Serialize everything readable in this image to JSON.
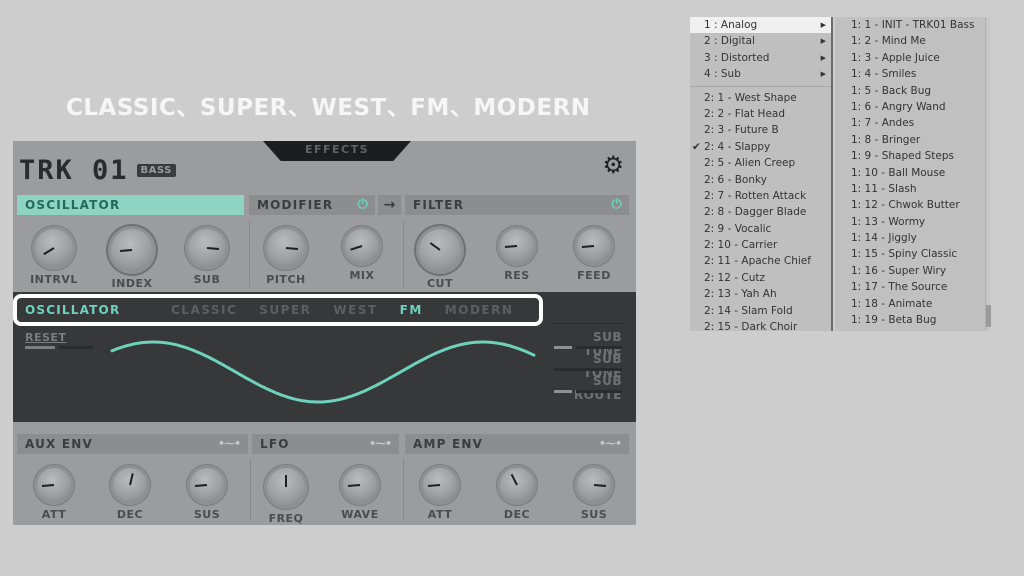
{
  "caption": "CLASSIC、SUPER、WEST、FM、MODERN",
  "synth": {
    "effects_tab": "EFFECTS",
    "logo": "TRK 01",
    "logo_badge": "BASS",
    "gear_icon": "gear-icon",
    "sections": {
      "oscillator": "OSCILLATOR",
      "modifier": "MODIFIER",
      "filter": "FILTER",
      "aux_env": "AUX ENV",
      "lfo": "LFO",
      "amp_env": "AMP ENV"
    },
    "arrow": "→",
    "power_icon": "⏻",
    "env_icon": "•⁓•",
    "knobs_top": [
      {
        "label": "INTRVL",
        "value": 0.05
      },
      {
        "label": "INDEX",
        "value": 0.15
      },
      {
        "label": "SUB",
        "value": 0.85
      },
      {
        "label": "PITCH",
        "value": 0.85
      },
      {
        "label": "MIX",
        "value": 0.1
      },
      {
        "label": "CUT",
        "value": 0.3
      },
      {
        "label": "RES",
        "value": 0.15
      },
      {
        "label": "FEED",
        "value": 0.15
      }
    ],
    "knobs_bottom": [
      {
        "label": "ATT",
        "value": 0.15
      },
      {
        "label": "DEC",
        "value": 0.55
      },
      {
        "label": "SUS",
        "value": 0.15
      },
      {
        "label": "FREQ",
        "value": 0.5
      },
      {
        "label": "WAVE",
        "value": 0.15
      },
      {
        "label": "ATT",
        "value": 0.15
      },
      {
        "label": "DEC",
        "value": 0.4
      },
      {
        "label": "SUS",
        "value": 0.85
      }
    ],
    "osc_panel": {
      "title": "OSCILLATOR",
      "tabs": [
        "CLASSIC",
        "SUPER",
        "WEST",
        "FM",
        "MODERN"
      ],
      "selected_tab": "FM",
      "reset": "RESET",
      "side_params": [
        "SUB TUNE",
        "SUB TONE",
        "SUB ROUTE"
      ]
    },
    "accent": "#6fd2bd"
  },
  "menu": {
    "categories": [
      {
        "label": "1 : Analog",
        "highlighted": true
      },
      {
        "label": "2 : Digital"
      },
      {
        "label": "3 : Distorted"
      },
      {
        "label": "4 : Sub"
      }
    ],
    "presets_left": [
      "2: 1 - West Shape",
      "2: 2 - Flat Head",
      "2: 3 - Future B",
      "2: 4 - Slappy",
      "2: 5 - Alien Creep",
      "2: 6 - Bonky",
      "2: 7 - Rotten Attack",
      "2: 8 - Dagger Blade",
      "2: 9 - Vocalic",
      "2: 10 - Carrier",
      "2: 11 - Apache Chief",
      "2: 12 - Cutz",
      "2: 13 - Yah Ah",
      "2: 14 - Slam Fold",
      "2: 15 - Dark Choir"
    ],
    "checked_left": "2: 4 - Slappy",
    "presets_right": [
      "1: 1 - INIT - TRK01 Bass",
      "1: 2 - Mind Me",
      "1: 3 - Apple Juice",
      "1: 4 - Smiles",
      "1: 5 - Back Bug",
      "1: 6 - Angry Wand",
      "1: 7 - Andes",
      "1: 8 - Bringer",
      "1: 9 - Shaped Steps",
      "1: 10 - Ball Mouse",
      "1: 11 - Slash",
      "1: 12 - Chwok Butter",
      "1: 13 - Wormy",
      "1: 14 - Jiggly",
      "1: 15 - Spiny Classic",
      "1: 16 - Super Wiry",
      "1: 17 - The Source",
      "1: 18 - Animate",
      "1: 19 - Beta Bug"
    ]
  }
}
